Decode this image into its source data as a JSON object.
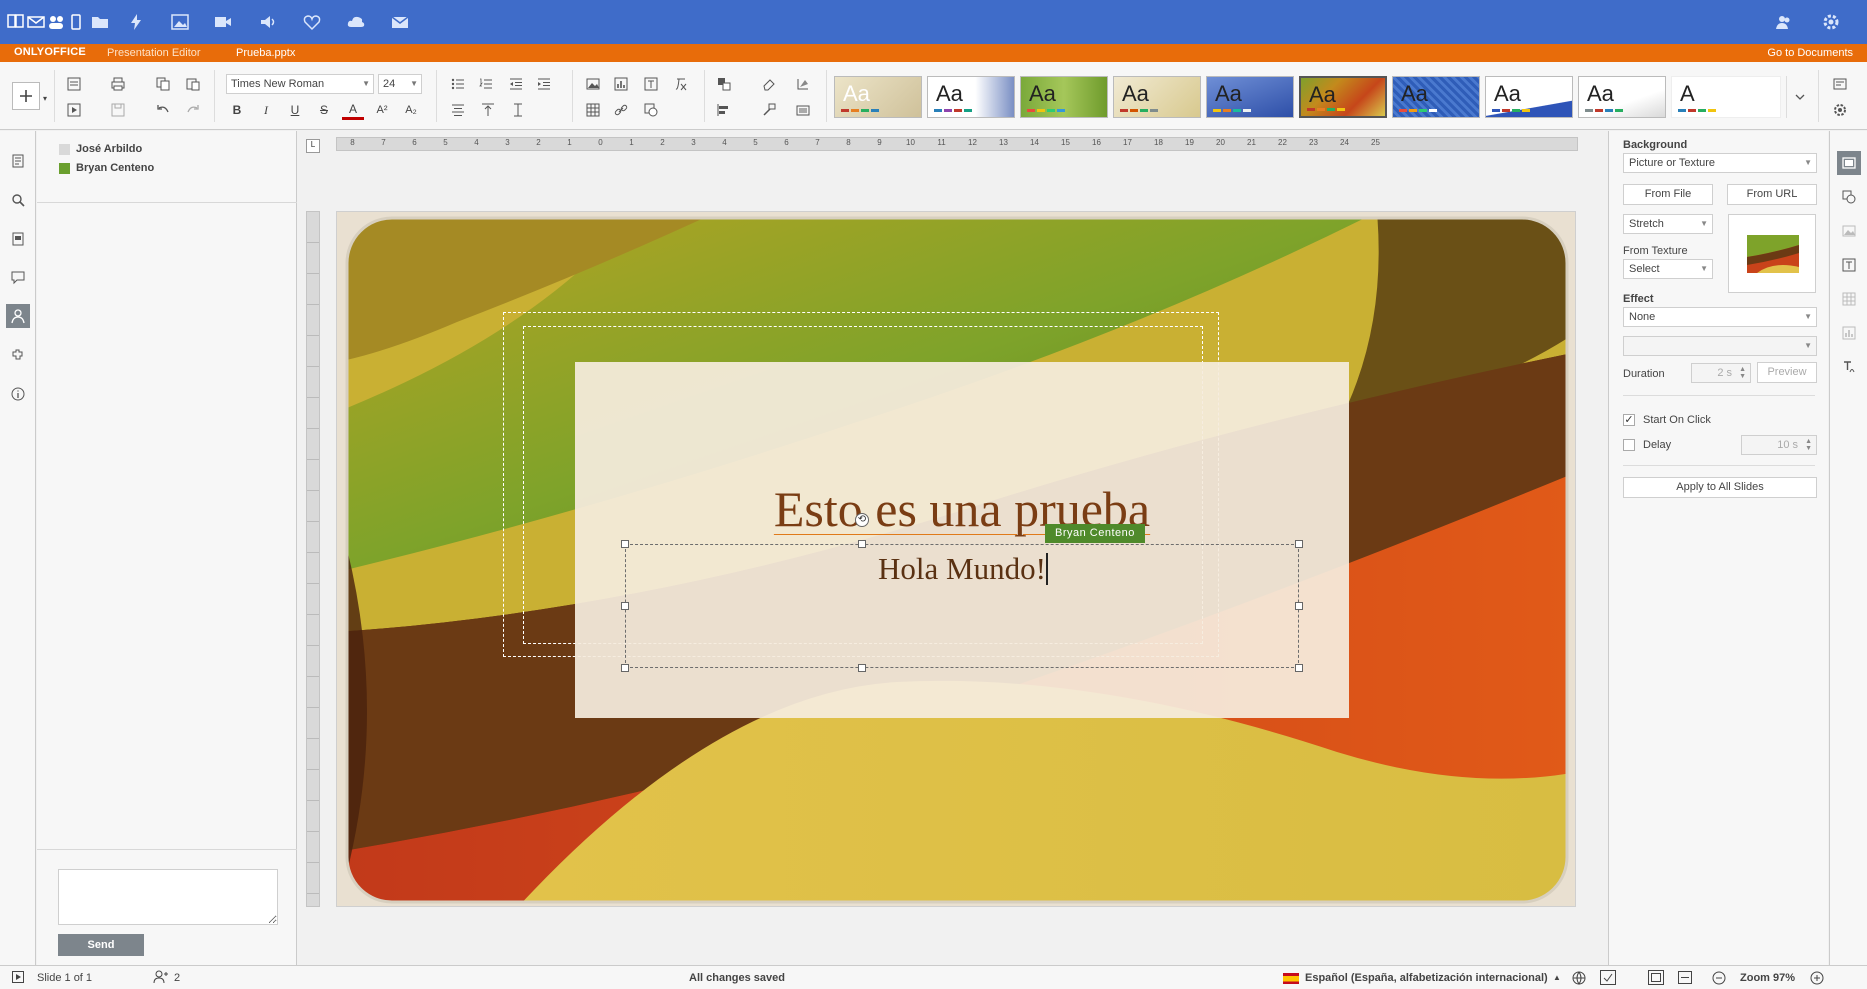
{
  "titlebar": {
    "logo": "ONLYOFFICE",
    "app_name": "Presentation Editor",
    "document_name": "Prueba.pptx",
    "go_to_documents": "Go to Documents"
  },
  "toolbar": {
    "font_name": "Times New Roman",
    "font_size": "24",
    "bold": "B",
    "italic": "I",
    "underline": "U",
    "strike": "S",
    "font_color": "A",
    "superscript": "A²",
    "subscript": "A₂",
    "theme_aa": "Aa",
    "theme_a": "A"
  },
  "users": [
    {
      "name": "José Arbildo",
      "color": "#d9d9d9"
    },
    {
      "name": "Bryan Centeno",
      "color": "#6a9f2e"
    }
  ],
  "chat": {
    "send_label": "Send"
  },
  "slide": {
    "title": "Esto es una prueba",
    "subtitle": "Hola Mundo!",
    "editing_user": "Bryan Centeno"
  },
  "settings": {
    "background_label": "Background",
    "fill_type": "Picture or Texture",
    "from_file": "From File",
    "from_url": "From URL",
    "stretch": "Stretch",
    "from_texture_label": "From Texture",
    "texture_select": "Select",
    "effect_label": "Effect",
    "effect_value": "None",
    "duration_label": "Duration",
    "duration_value": "2 s",
    "preview": "Preview",
    "start_on_click": "Start On Click",
    "delay_label": "Delay",
    "delay_value": "10 s",
    "apply_all": "Apply to All Slides"
  },
  "status": {
    "slide_counter": "Slide 1 of 1",
    "users_count": "2",
    "save_status": "All changes saved",
    "language": "Español (España, alfabetización internacional)",
    "zoom": "Zoom 97%"
  },
  "colors": {
    "topbar": "#3f6cc9",
    "titlebar": "#e86c0a",
    "title_text": "#7a3d14",
    "user_tag": "#4f8a2b"
  }
}
